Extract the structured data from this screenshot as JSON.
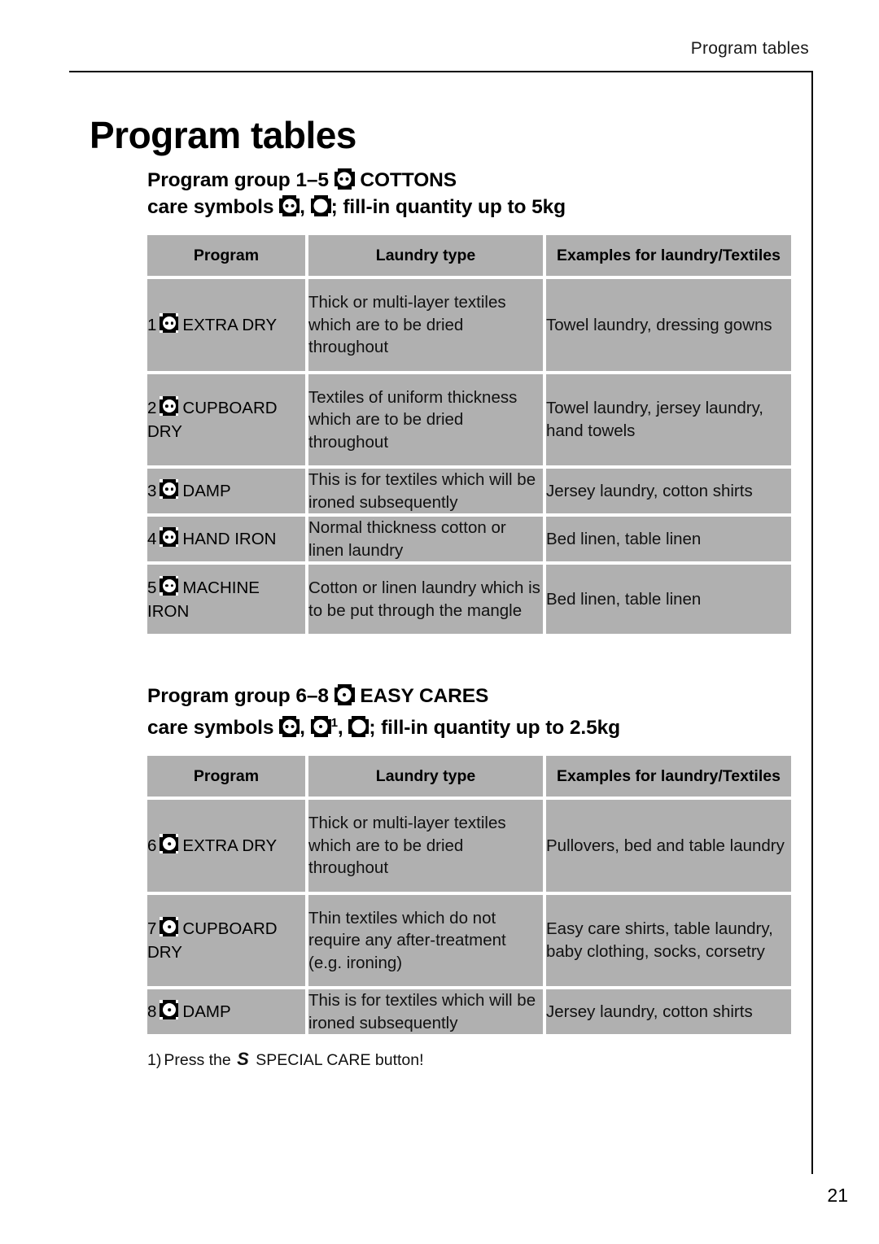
{
  "running_header": "Program tables",
  "page_title": "Program tables",
  "page_number": "21",
  "colors": {
    "cell_gray": "#b0b0b0",
    "rule_black": "#000000",
    "text": "#111111"
  },
  "symbols": {
    "cottons": {
      "name": "care-symbol-two-dots",
      "dots": 2
    },
    "easy_cares": {
      "name": "care-symbol-one-dot",
      "dots": 1
    },
    "empty": {
      "name": "care-symbol-no-dot",
      "dots": 0
    }
  },
  "sections": [
    {
      "heading_line1_pre": "Program group 1–5 ",
      "heading_line1_post": " COTTONS",
      "heading_line2_pre": "care symbols ",
      "heading_line2_mid": ", ",
      "heading_line2_post": "; fill-in quantity up to 5kg",
      "columns": [
        "Program",
        "Laundry type",
        "Examples for laundry/Textiles"
      ],
      "rows": [
        {
          "number": "1",
          "program": "EXTRA DRY",
          "laundry_type": "Thick or multi-layer textiles which are to be dried throughout",
          "examples": "Towel laundry, dressing gowns"
        },
        {
          "number": "2",
          "program": "CUPBOARD DRY",
          "laundry_type": "Textiles of uniform thickness which are to be dried throughout",
          "examples": "Towel laundry, jersey laundry, hand towels"
        },
        {
          "number": "3",
          "program": "DAMP",
          "laundry_type": "This is for textiles which will be ironed subsequently",
          "examples": "Jersey laundry, cotton shirts"
        },
        {
          "number": "4",
          "program": "HAND IRON",
          "laundry_type": "Normal thickness cotton or linen laundry",
          "examples": "Bed linen, table linen"
        },
        {
          "number": "5",
          "program": "MACHINE IRON",
          "laundry_type": "Cotton or linen laundry which is to be put through the mangle",
          "examples": "Bed linen, table linen"
        }
      ]
    },
    {
      "heading_line1_pre": "Program group 6–8 ",
      "heading_line1_post": " EASY CARES",
      "heading_line2_pre": "care symbols ",
      "heading_line2_mid": ", ",
      "heading_line2_mid2": ", ",
      "heading_line2_post": "; fill-in quantity up to 2.5kg",
      "heading_footnote_marker": "1",
      "columns": [
        "Program",
        "Laundry type",
        "Examples for laundry/Textiles"
      ],
      "rows": [
        {
          "number": "6",
          "program": "EXTRA DRY",
          "laundry_type": "Thick or multi-layer textiles which are to be dried throughout",
          "examples": "Pullovers, bed and table laundry"
        },
        {
          "number": "7",
          "program": "CUPBOARD DRY",
          "laundry_type": "Thin textiles which do not require any after-treatment (e.g. ironing)",
          "examples": "Easy care shirts, table laundry, baby clothing, socks, corsetry"
        },
        {
          "number": "8",
          "program": "DAMP",
          "laundry_type": "This is for textiles which will be ironed subsequently",
          "examples": "Jersey laundry, cotton shirts"
        }
      ]
    }
  ],
  "footnote": {
    "marker": "1)",
    "text_before": "Press the ",
    "button_glyph": "S",
    "text_after": " SPECIAL CARE button!"
  }
}
